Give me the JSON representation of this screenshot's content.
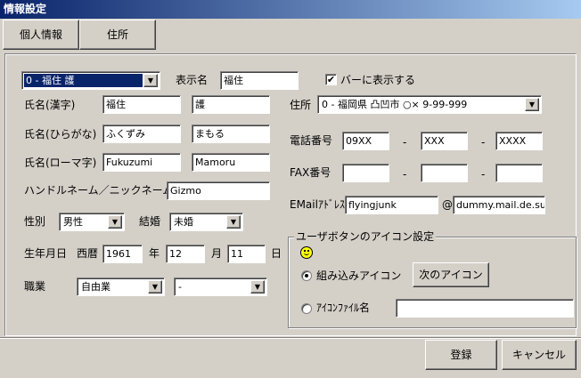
{
  "window": {
    "title": "情報設定"
  },
  "tabs": [
    {
      "label": "個人情報"
    },
    {
      "label": "住所"
    }
  ],
  "profile_select": {
    "value": "0 - 福住 護"
  },
  "display_name": {
    "label": "表示名",
    "value": "福住"
  },
  "show_in_bar": {
    "label": "バーに表示する",
    "checked": true
  },
  "name_kanji": {
    "label": "氏名(漢字)",
    "last": "福住",
    "first": "護"
  },
  "name_hiragana": {
    "label": "氏名(ひらがな)",
    "last": "ふくずみ",
    "first": "まもる"
  },
  "name_roman": {
    "label": "氏名(ローマ字)",
    "last": "Fukuzumi",
    "first": "Mamoru"
  },
  "handle": {
    "label": "ハンドルネーム／ニックネーム",
    "value": "Gizmo"
  },
  "gender": {
    "label": "性別",
    "value": "男性"
  },
  "marriage": {
    "label": "結婚",
    "value": "未婚"
  },
  "birth": {
    "label": "生年月日",
    "era": "西暦",
    "year": "1961",
    "year_unit": "年",
    "month": "12",
    "month_unit": "月",
    "day": "11",
    "day_unit": "日"
  },
  "occupation": {
    "label": "職業",
    "value": "自由業",
    "sub_value": "-"
  },
  "address": {
    "label": "住所",
    "value": "0 - 福岡県 凸凹市 ○× 9-99-999"
  },
  "phone": {
    "label": "電話番号",
    "part1": "09XX",
    "sep1": "-",
    "part2": "XXX",
    "sep2": "-",
    "part3": "XXXX"
  },
  "fax": {
    "label": "FAX番号",
    "part1": "",
    "sep1": "-",
    "part2": "",
    "sep2": "-",
    "part3": ""
  },
  "email": {
    "label": "EMailｱﾄﾞﾚｽ",
    "user": "flyingjunk",
    "at": "@",
    "domain": "dummy.mail.de.su"
  },
  "icon_group": {
    "title": "ユーザボタンのアイコン設定",
    "builtin_label": "組み込みアイコン",
    "builtin_selected": true,
    "next_button": "次のアイコン",
    "file_label": "ｱｲｺﾝﾌｧｲﾙ名",
    "file_value": ""
  },
  "buttons": {
    "register": "登録",
    "cancel": "キャンセル"
  }
}
